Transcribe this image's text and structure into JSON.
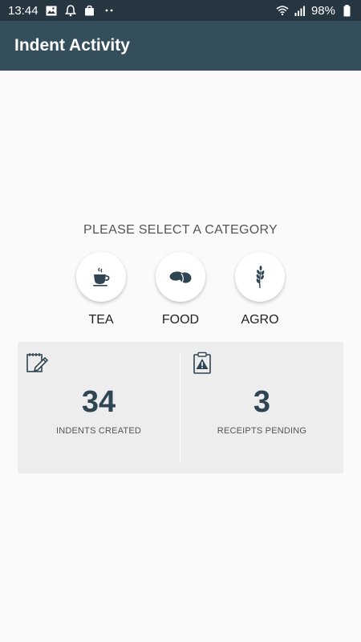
{
  "status_bar": {
    "time": "13:44",
    "battery": "98%",
    "left_icons": [
      "image-icon",
      "notification-bell-icon",
      "shopping-bag-icon",
      "more-dots-icon"
    ],
    "right_icons": [
      "wifi-icon",
      "signal-icon",
      "battery-icon"
    ]
  },
  "app_bar": {
    "title": "Indent Activity",
    "color": "#344e5b"
  },
  "main": {
    "prompt": "PLEASE SELECT A CATEGORY",
    "categories": [
      {
        "label": "TEA",
        "icon": "tea-cup-icon"
      },
      {
        "label": "FOOD",
        "icon": "food-beans-icon"
      },
      {
        "label": "AGRO",
        "icon": "wheat-icon"
      }
    ]
  },
  "stats": [
    {
      "value": "34",
      "caption": "INDENTS CREATED",
      "icon": "edit-notepad-icon"
    },
    {
      "value": "3",
      "caption": "RECEIPTS PENDING",
      "icon": "clipboard-warning-icon"
    }
  ],
  "colors": {
    "accent": "#2f4553",
    "status_bar": "#263640",
    "background": "#fafafa",
    "stats_background": "#ededed"
  }
}
